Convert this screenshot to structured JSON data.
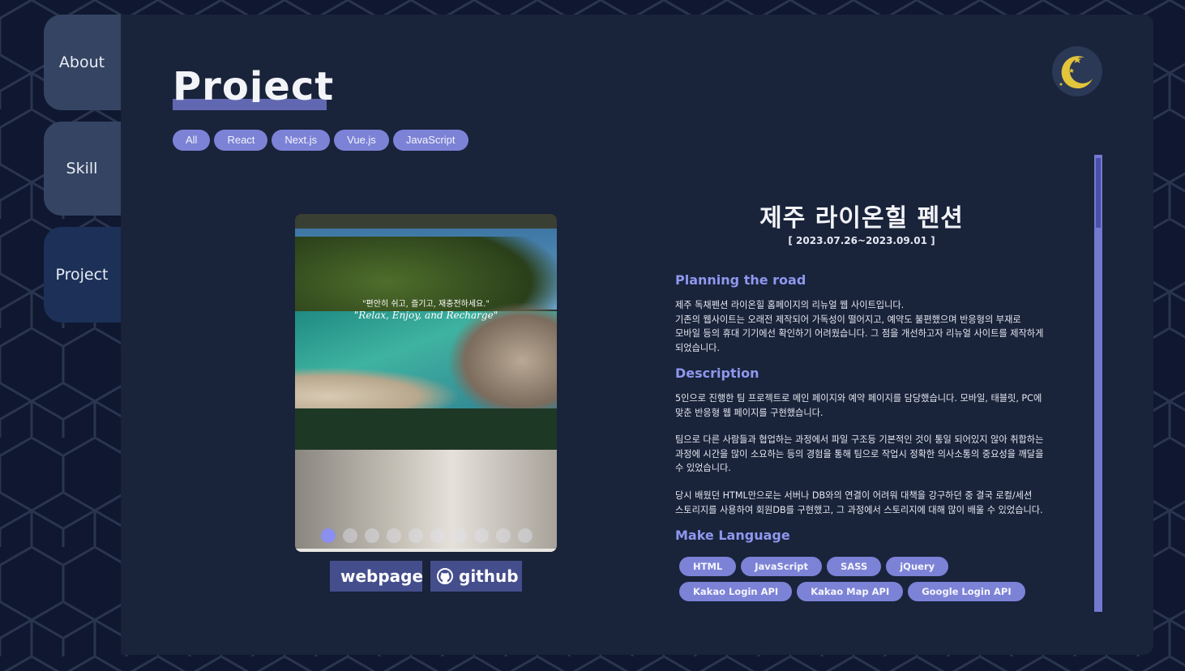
{
  "nav": {
    "tabs": [
      {
        "label": "About",
        "active": false
      },
      {
        "label": "Skill",
        "active": false
      },
      {
        "label": "Project",
        "active": true
      }
    ]
  },
  "header": {
    "title": "Project",
    "theme_icon": "moon-icon"
  },
  "filters": [
    "All",
    "React",
    "Next.js",
    "Vue.js",
    "JavaScript"
  ],
  "preview": {
    "tagline_ko": "\"편안히 쉬고, 즐기고, 재충전하세요.\"",
    "tagline_en": "\"Relax, Enjoy, and Recharge\"",
    "slide_count": 10,
    "active_slide": 1
  },
  "links": {
    "webpage_label": "webpage",
    "webpage_icon": "link-icon",
    "github_label": "github",
    "github_icon": "github-icon"
  },
  "project": {
    "title": "제주 라이온힐 펜션",
    "date": "[ 2023.07.26~2023.09.01 ]",
    "sections": [
      {
        "heading": "Planning the road",
        "paragraphs": [
          "제주 독채펜션 라이온힐 홈페이지의 리뉴얼 웹 사이트입니다.",
          "기존의 웹사이트는 오래전 제작되어 가독성이 떨어지고, 예약도 불편했으며 반응형의 부재로",
          "모바일 등의 휴대 기기에선 확인하기 어려웠습니다. 그 점을 개선하고자 리뉴얼 사이트를 제작하게",
          "되었습니다."
        ]
      },
      {
        "heading": "Description",
        "paragraphs": [
          "5인으로 진행한 팀 프로젝트로 메인 페이지와 예약 페이지를 담당했습니다. 모바일, 태블릿, PC에",
          "맞춘 반응형 웹 페이지를 구현했습니다.",
          "팀으로 다른 사람들과 협업하는 과정에서 파일 구조등 기본적인 것이 통일 되어있지 않아 취합하는",
          "과정에 시간을 많이 소요하는 등의 경험을 통해 팀으로 작업시 정확한 의사소통의 중요성을 깨달을",
          "수 있었습니다.",
          "당시 배웠던 HTML만으로는 서버나 DB와의 연결이 어려워 대책을 강구하던 중 결국 로컬/세션",
          "스토리지를 사용하여 회원DB를 구현했고, 그 과정에서 스토리지에 대해 많이 배울 수 있었습니다."
        ]
      },
      {
        "heading": "Make Language",
        "chips": [
          "HTML",
          "JavaScript",
          "SASS",
          "jQuery",
          "Kakao Login API",
          "Kakao Map API",
          "Google Login API"
        ]
      }
    ]
  },
  "colors": {
    "page_bg": "#0f1830",
    "panel_bg": "#19233a",
    "accent": "#7c82d6",
    "heading_accent": "#8f97ee",
    "tab_inactive": "#354462",
    "tab_active": "#1c3058"
  }
}
